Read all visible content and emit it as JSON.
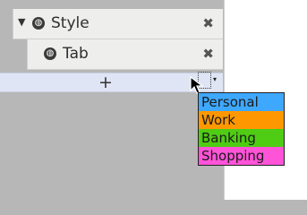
{
  "tree": {
    "items": [
      {
        "label": "Style",
        "expanded": true,
        "icon": "globe-icon"
      },
      {
        "label": "Tab",
        "icon": "globe-icon"
      }
    ],
    "toggle_glyph": "▼",
    "globe_glyph": "◍",
    "close_glyph": "✖"
  },
  "add_bar": {
    "label": "+"
  },
  "dropdown": {
    "arrow_glyph": "▾",
    "options": [
      {
        "label": "Personal",
        "color": "#3ea8ff"
      },
      {
        "label": "Work",
        "color": "#ff9800"
      },
      {
        "label": "Banking",
        "color": "#4fcc14"
      },
      {
        "label": "Shopping",
        "color": "#ff53d8"
      }
    ]
  }
}
